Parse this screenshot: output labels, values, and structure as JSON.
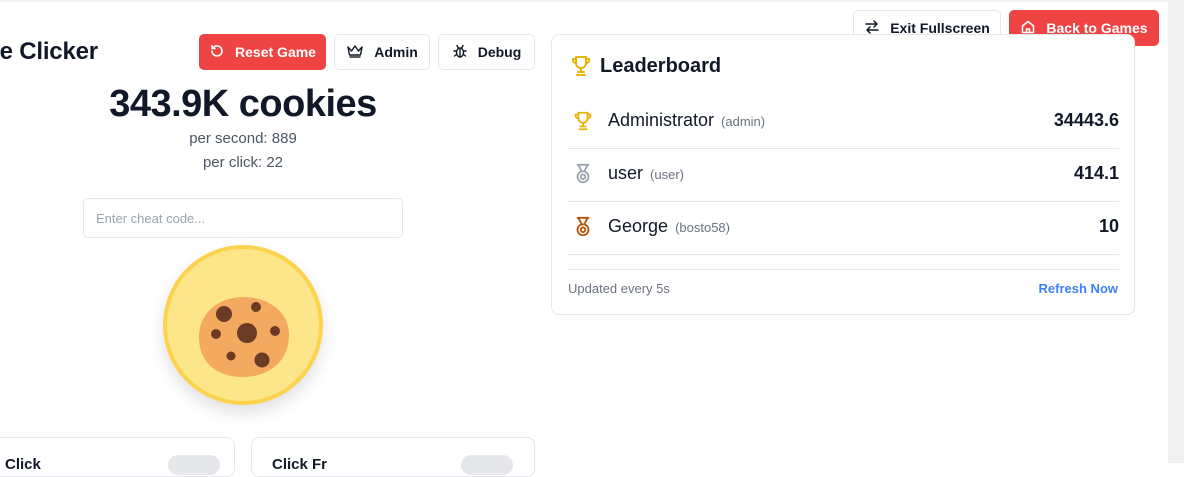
{
  "header": {
    "exit_fullscreen_label": "Exit Fullscreen",
    "back_to_games_label": "Back to Games"
  },
  "game": {
    "title": "kie Clicker",
    "reset_label": "Reset Game",
    "admin_label": "Admin",
    "debug_label": "Debug",
    "cookie_count": "343.9K cookies",
    "per_second": "per second: 889",
    "per_click": "per click: 22",
    "cheat_placeholder": "Enter cheat code...",
    "cheat_value": ""
  },
  "upgrades": [
    {
      "name": "Click"
    },
    {
      "name": "Click Fr"
    }
  ],
  "leaderboard": {
    "title": "Leaderboard",
    "entries": [
      {
        "rank_icon": "trophy-icon",
        "name": "Administrator",
        "username": "(admin)",
        "score": "34443.6"
      },
      {
        "rank_icon": "silver-medal-icon",
        "name": "user",
        "username": "(user)",
        "score": "414.1"
      },
      {
        "rank_icon": "bronze-medal-icon",
        "name": "George",
        "username": "(bosto58)",
        "score": "10"
      }
    ],
    "updated_text": "Updated every 5s",
    "refresh_label": "Refresh Now"
  },
  "colors": {
    "accent_red": "#ef4444",
    "trophy_gold": "#eab308",
    "medal_silver": "#9ca3af",
    "medal_bronze": "#b45309",
    "link_blue": "#3b82f6",
    "cookie_bg": "#fde68a"
  }
}
